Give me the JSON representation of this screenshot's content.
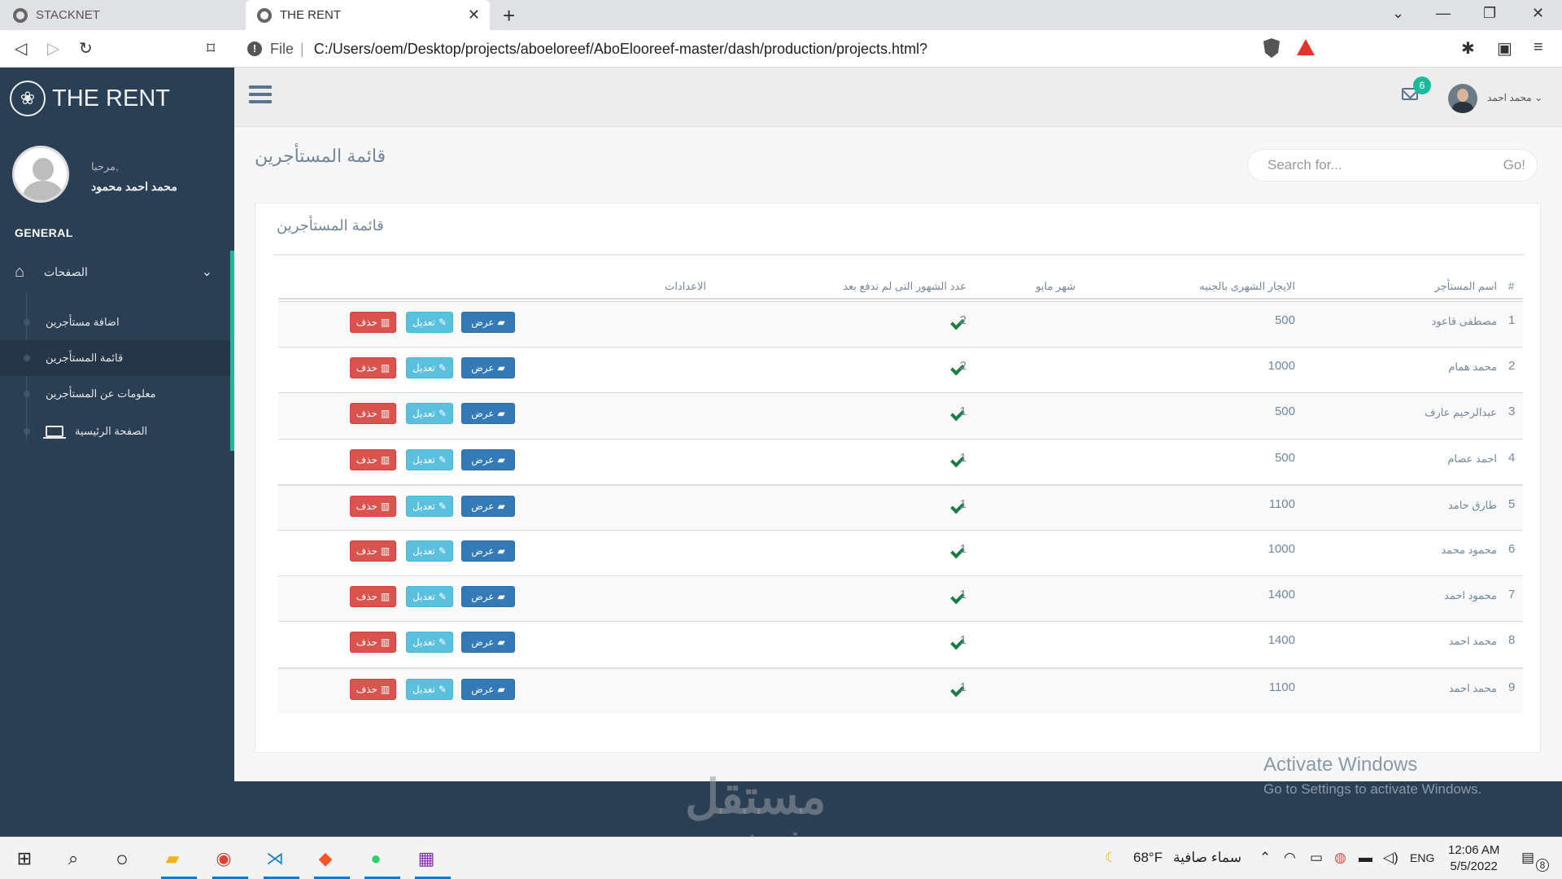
{
  "browser": {
    "inactive_tab": "STACKNET",
    "active_tab": "THE RENT",
    "url_scheme": "File",
    "url": "C:/Users/oem/Desktop/projects/aboeloreef/AboElooreef-master/dash/production/projects.html?"
  },
  "sidebar": {
    "brand": "THE RENT",
    "welcome": "مرحبا,",
    "username": "محمد احمد محمود",
    "section": "GENERAL",
    "menu_label": "الصفحات",
    "items": [
      {
        "label": "اضافة مستأجرين"
      },
      {
        "label": "قائمة المستأجرين"
      },
      {
        "label": "معلومات عن المستأجرين"
      },
      {
        "label": "الصفحة الرئيسية"
      }
    ]
  },
  "topnav": {
    "mail_count": "6",
    "user": "محمد احمد"
  },
  "page": {
    "title": "قائمة المستأجرين",
    "search_placeholder": "Search for...",
    "search_button": "Go!",
    "panel_title": "قائمة المستأجرين"
  },
  "table": {
    "headers": {
      "num": "#",
      "name": "اسم المستأجر",
      "rent": "الايجار الشهرى بالجنيه",
      "may": "شهر مايو",
      "unpaid": "عدد الشهور التى لم تدفع بعد",
      "settings": "الاعدادات"
    },
    "actions": {
      "view": "عرض",
      "edit": "تعديل",
      "delete": "حذف"
    },
    "rows": [
      {
        "num": "1",
        "name": "مصطفى قاعود",
        "rent": "500",
        "unpaid": "2",
        "may_paid": true
      },
      {
        "num": "2",
        "name": "محمد همام",
        "rent": "1000",
        "unpaid": "2",
        "may_paid": true
      },
      {
        "num": "3",
        "name": "عبدالرحيم عارف",
        "rent": "500",
        "unpaid": "1",
        "may_paid": true
      },
      {
        "num": "4",
        "name": "احمد عصام",
        "rent": "500",
        "unpaid": "1",
        "may_paid": true
      },
      {
        "num": "5",
        "name": "طارق حامد",
        "rent": "1100",
        "unpaid": "1",
        "may_paid": true
      },
      {
        "num": "6",
        "name": "محمود محمد",
        "rent": "1000",
        "unpaid": "1",
        "may_paid": true
      },
      {
        "num": "7",
        "name": "محمود احمد",
        "rent": "1400",
        "unpaid": "1",
        "may_paid": true
      },
      {
        "num": "8",
        "name": "محمد احمد",
        "rent": "1400",
        "unpaid": "1",
        "may_paid": true
      },
      {
        "num": "9",
        "name": "محمد احمد",
        "rent": "1100",
        "unpaid": "1",
        "may_paid": true
      }
    ]
  },
  "overlay": {
    "activate_title": "Activate Windows",
    "activate_sub": "Go to Settings to activate Windows.",
    "watermark_ar": "مستقل",
    "watermark_en": "mostaqi.com"
  },
  "taskbar": {
    "weather_temp": "68°F",
    "weather_text": "سماء صافية",
    "lang": "ENG",
    "time": "12:06 AM",
    "date": "5/5/2022",
    "notifications": "8"
  },
  "colors": {
    "sidebar_bg": "#2a3f54",
    "accent": "#1abb9c",
    "btn_view": "#337ab7",
    "btn_edit": "#5bc0de",
    "btn_delete": "#d9534f",
    "check": "#1a7d43"
  }
}
